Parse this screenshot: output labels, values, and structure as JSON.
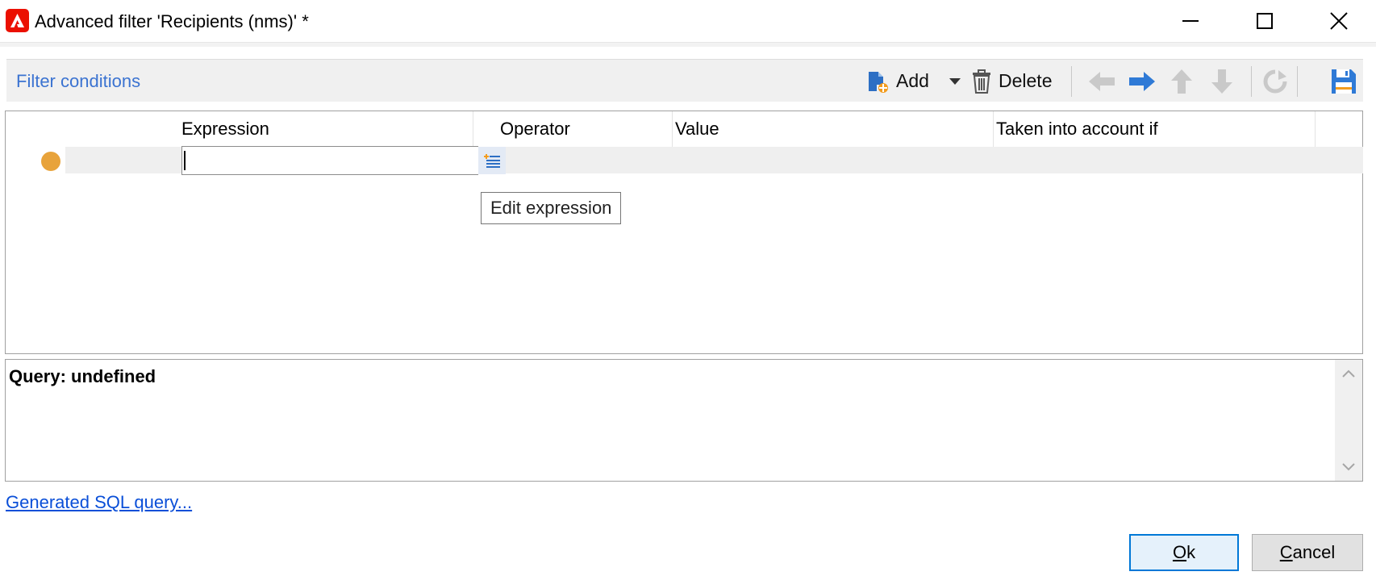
{
  "window": {
    "title": "Advanced filter 'Recipients (nms)' *",
    "app_icon": "adobe-campaign-icon",
    "controls": [
      "minimize-icon",
      "maximize-icon",
      "close-icon"
    ]
  },
  "toolbar": {
    "title": "Filter conditions",
    "add_label": "Add",
    "delete_label": "Delete",
    "icons": [
      "add-icon",
      "dropdown-arrow-icon",
      "trash-icon",
      "arrow-left-icon",
      "arrow-right-icon",
      "arrow-up-icon",
      "arrow-down-icon",
      "refresh-icon",
      "save-icon"
    ]
  },
  "grid": {
    "columns": [
      "Expression",
      "Operator",
      "Value",
      "Taken into account if"
    ],
    "rows": [
      {
        "expression": "",
        "operator": "",
        "value": "",
        "condition": "",
        "status_color": "#e8a33b"
      }
    ],
    "tooltip": "Edit expression"
  },
  "query": {
    "text": "Query: undefined"
  },
  "links": {
    "sql": "Generated SQL query..."
  },
  "buttons": {
    "ok_mnemonic": "O",
    "ok_rest": "k",
    "cancel_mnemonic": "C",
    "cancel_rest": "ancel"
  },
  "colors": {
    "accent": "#3b73d1",
    "link": "#0a4fd8",
    "brand": "#eb1000",
    "ok_border": "#0078d7"
  }
}
